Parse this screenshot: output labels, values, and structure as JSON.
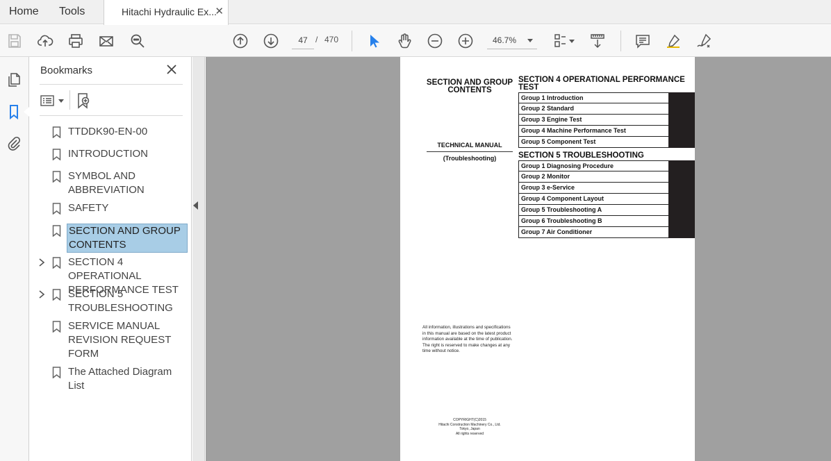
{
  "tabs": {
    "home": "Home",
    "tools": "Tools",
    "document": "Hitachi Hydraulic Ex...",
    "close": "✕"
  },
  "toolbar": {
    "current_page": "47",
    "page_separator": "/",
    "total_pages": "470",
    "zoom": "46.7%"
  },
  "bookmarks": {
    "title": "Bookmarks",
    "items": [
      {
        "label": "TTDDK90-EN-00",
        "expandable": false
      },
      {
        "label": "INTRODUCTION",
        "expandable": false
      },
      {
        "label": "SYMBOL AND ABBREVIATION",
        "expandable": false
      },
      {
        "label": "SAFETY",
        "expandable": false
      },
      {
        "label": "SECTION AND GROUP CONTENTS",
        "expandable": false,
        "selected": true
      },
      {
        "label": "SECTION 4 OPERATIONAL PERFORMANCE TEST",
        "expandable": true
      },
      {
        "label": "SECTION 5 TROUBLESHOOTING",
        "expandable": true
      },
      {
        "label": "SERVICE MANUAL REVISION REQUEST FORM",
        "expandable": false
      },
      {
        "label": "The Attached Diagram List",
        "expandable": false
      }
    ]
  },
  "document_page": {
    "left_title": "SECTION AND GROUP CONTENTS",
    "manual_type": "TECHNICAL MANUAL",
    "manual_subtype": "(Troubleshooting)",
    "section4": {
      "title": "SECTION 4 OPERATIONAL PERFORMANCE TEST",
      "groups": [
        "Group 1 Introduction",
        "Group 2 Standard",
        "Group 3 Engine Test",
        "Group 4 Machine Performance Test",
        "Group 5 Component Test"
      ]
    },
    "section5": {
      "title": "SECTION 5 TROUBLESHOOTING",
      "groups": [
        "Group 1 Diagnosing Procedure",
        "Group 2 Monitor",
        "Group 3 e-Service",
        "Group 4 Component Layout",
        "Group 5 Troubleshooting A",
        "Group 6 Troubleshooting B",
        "Group 7 Air Conditioner"
      ]
    },
    "note": "All information, illustrations and specifications in this manual are based on the latest product information available at the time of publication. The right is reserved to make changes at any time without notice.",
    "copyright": [
      "COPYRIGHT(C)2015",
      "Hitachi Construction Machinery Co., Ltd.",
      "Tokyo, Japan",
      "All rights reserved"
    ]
  },
  "colors": {
    "selection": "#a8cde6",
    "accent": "#2680eb",
    "page_bg": "#a0a0a0"
  }
}
